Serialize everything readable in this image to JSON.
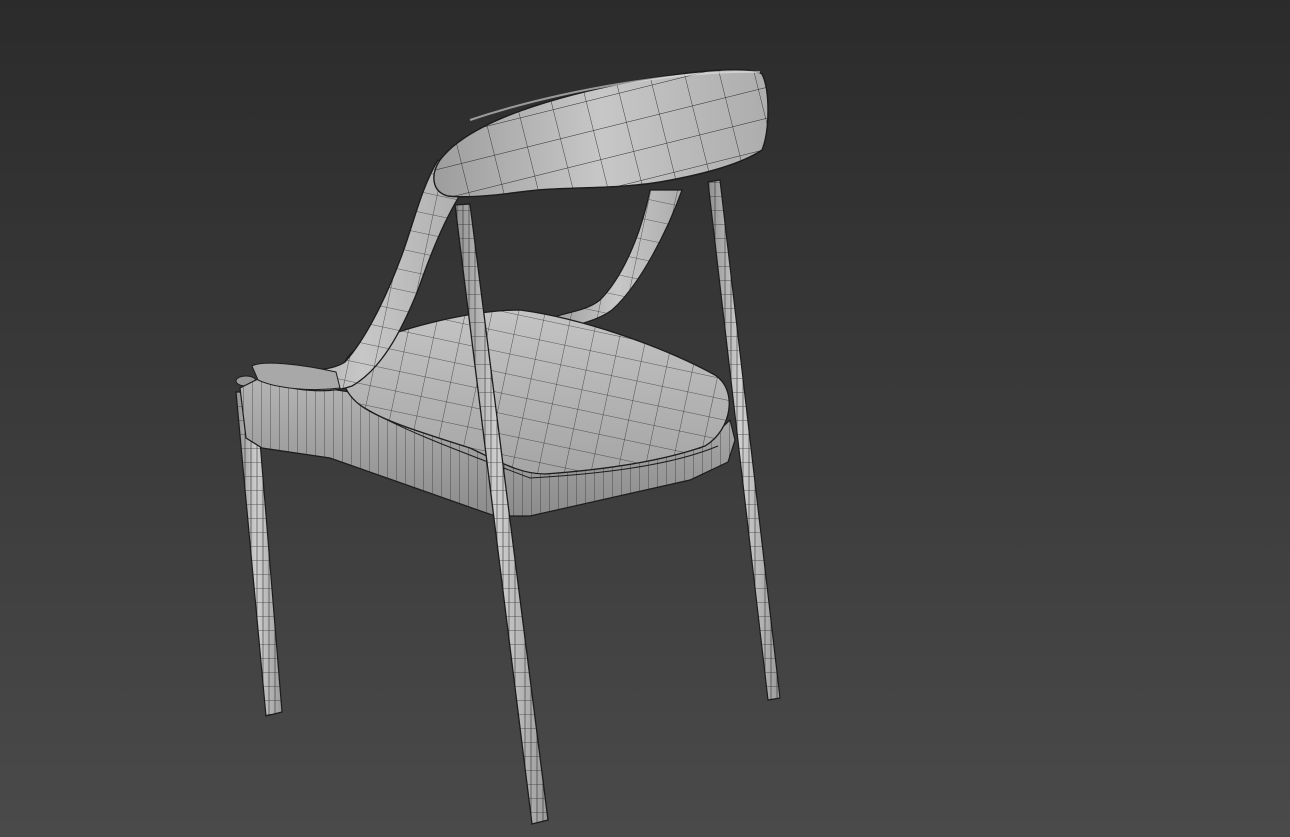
{
  "viewport": {
    "background_top": "#2b2b2b",
    "background_bottom": "#4a4a4a"
  },
  "model": {
    "object": "chair",
    "shading": "grey-shaded-with-wireframe-edges",
    "surface_color": "#b9b9b9",
    "surface_highlight": "#d8d8d8",
    "surface_shadow": "#8e8e8e",
    "wire_color": "#1c1c1c"
  }
}
